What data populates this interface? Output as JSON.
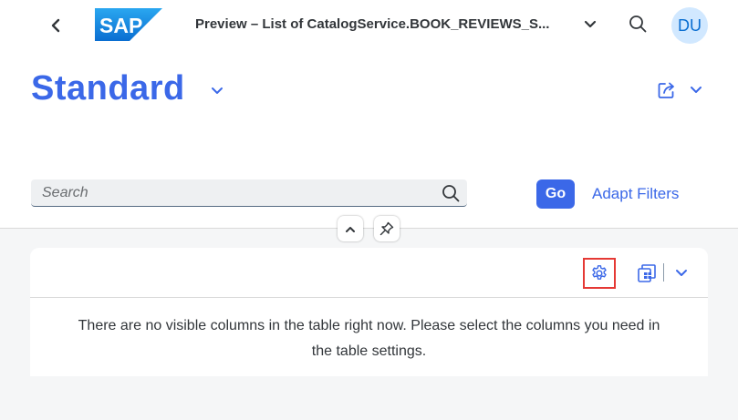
{
  "shell": {
    "logo_text": "SAP",
    "title": "Preview – List of CatalogService.BOOK_REVIEWS_S...",
    "avatar_initials": "DU"
  },
  "header": {
    "variant_title": "Standard"
  },
  "filterbar": {
    "search_placeholder": "Search",
    "go_label": "Go",
    "adapt_filters_label": "Adapt Filters"
  },
  "table": {
    "empty_message_line1": "There are no visible columns in the table right now. Please select the columns you need in",
    "empty_message_line2": "the table settings."
  },
  "colors": {
    "accent": "#3b68e8",
    "highlight_border": "#e53935",
    "avatar_bg": "#d1e8ff"
  }
}
